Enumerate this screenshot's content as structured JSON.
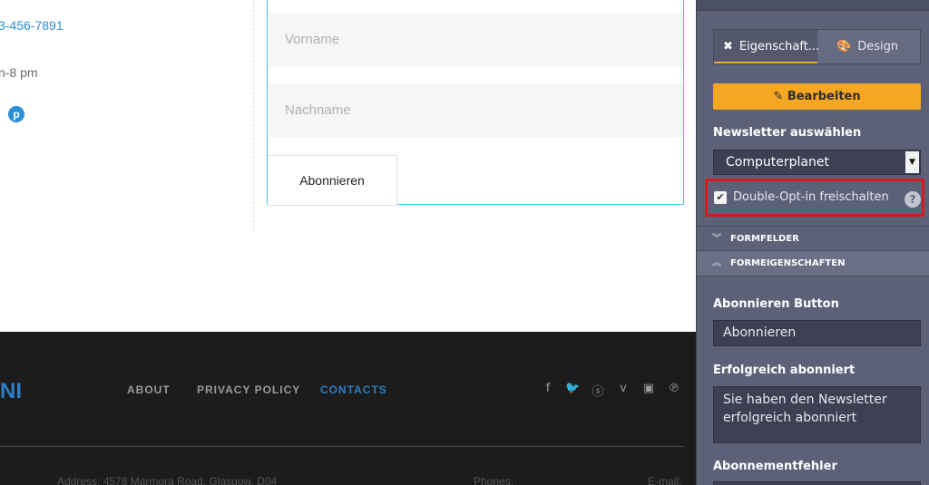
{
  "page": {
    "phone": "3-456-7891",
    "hours": "n-8 pm",
    "pinterest_glyph": "p"
  },
  "form": {
    "first_name_placeholder": "Vorname",
    "last_name_placeholder": "Nachname",
    "subscribe_label": "Abonnieren"
  },
  "footer": {
    "logo_fragment": "NI",
    "nav": [
      "ABOUT",
      "PRIVACY POLICY",
      "CONTACTS"
    ],
    "social": [
      "facebook-icon",
      "twitter-icon",
      "skype-icon",
      "vimeo-icon",
      "youtube-icon",
      "pinterest-icon"
    ],
    "address": "Address: 4578 Marmora Road, Glasgow, D04",
    "phones_label": "Phones:",
    "email_label": "E-mail:"
  },
  "panel": {
    "tabs": {
      "properties": "Eigenschaft...",
      "design": "Design"
    },
    "edit_label": "Bearbeiten",
    "newsletter_label": "Newsletter auswählen",
    "newsletter_value": "Computerplanet",
    "double_opt_in_label": "Double-Opt-in freischalten",
    "double_opt_in_checked": true,
    "help_glyph": "?",
    "sections": {
      "form_fields": "FORMFELDER",
      "form_properties": "FORMEIGENSCHAFTEN"
    },
    "subscribe_button_label": "Abonnieren Button",
    "subscribe_button_value": "Abonnieren",
    "success_label": "Erfolgreich abonniert",
    "success_value": "Sie haben den Newsletter\nerfolgreich abonniert",
    "error_label": "Abonnementfehler"
  },
  "colors": {
    "accent": "#f5a623",
    "link": "#2c8fd6",
    "panel_bg": "#5c6178",
    "highlight": "#d51c1c",
    "form_border": "#3cc9e8"
  }
}
